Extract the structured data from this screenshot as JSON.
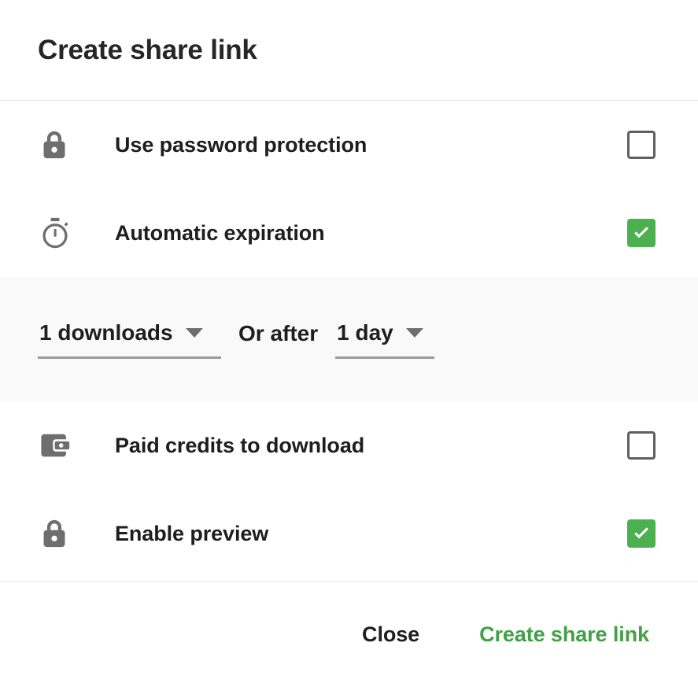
{
  "dialog": {
    "title": "Create share link"
  },
  "options": [
    {
      "id": "use-password-protection",
      "icon": "lock-icon",
      "label": "Use password protection",
      "checked": false
    },
    {
      "id": "automatic-expiration",
      "icon": "timer-icon",
      "label": "Automatic expiration",
      "checked": true
    },
    {
      "id": "paid-credits-to-download",
      "icon": "wallet-icon",
      "label": "Paid credits to download",
      "checked": false
    },
    {
      "id": "enable-preview",
      "icon": "lock-icon",
      "label": "Enable preview",
      "checked": true
    }
  ],
  "expiration_settings": {
    "downloads_dropdown": {
      "value": "1 downloads",
      "caret": "chevron-down-icon"
    },
    "conjunction": "Or after",
    "duration_dropdown": {
      "value": "1 day",
      "caret": "chevron-down-icon"
    }
  },
  "footer": {
    "close_label": "Close",
    "create_label": "Create share link"
  },
  "colors": {
    "accent_green": "#4caf50",
    "primary_action_text": "#43a047",
    "icon_gray": "#6e6e6e",
    "checkbox_border": "#5f5f5f",
    "divider": "#e3e3e3",
    "band_background": "#f9f9f9",
    "text_dark": "#1e1e1e"
  }
}
